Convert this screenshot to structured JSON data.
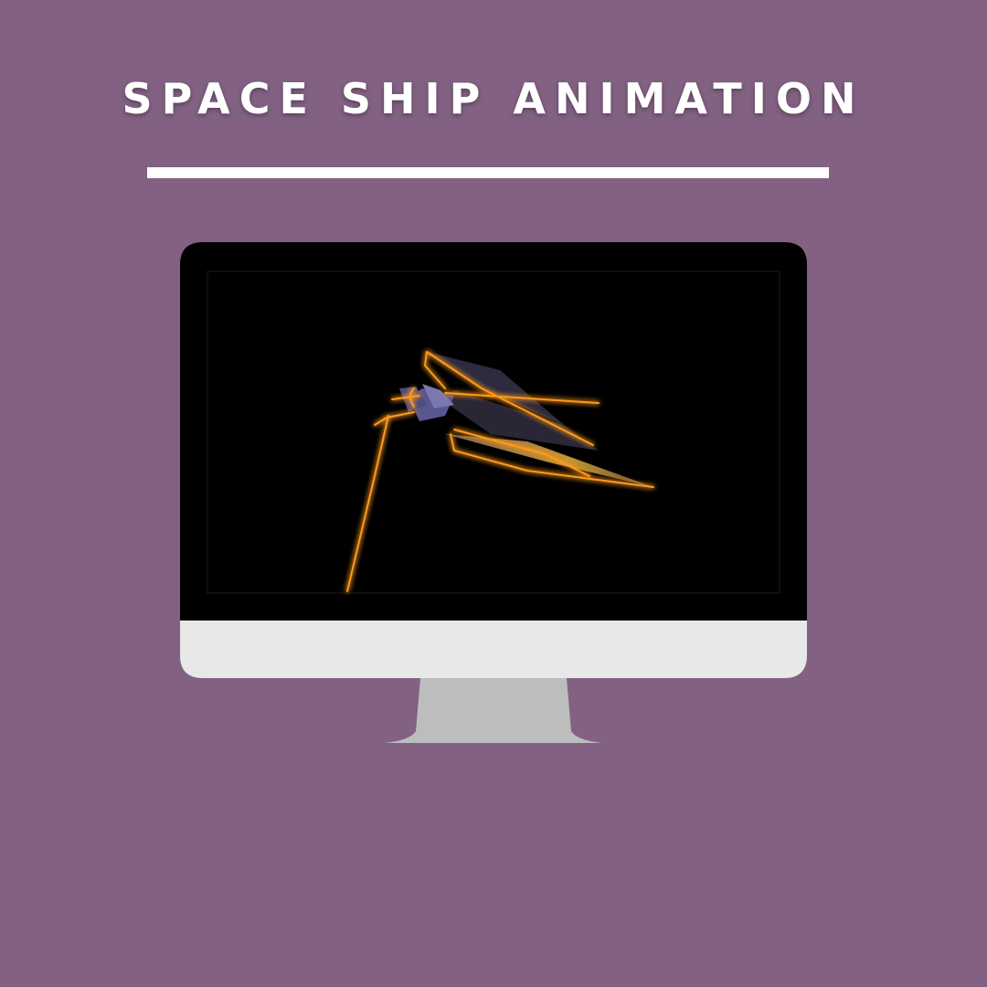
{
  "title": "SPACE SHIP ANIMATION",
  "colors": {
    "background": "#826182",
    "title_text": "#ffffff",
    "rule": "#ffffff",
    "monitor_bezel": "#000000",
    "monitor_chin": "#e8e8e8",
    "monitor_stand": "#bdbdbd",
    "ship_glow": "#ff9a1f",
    "ship_body": "#4a4870"
  },
  "icons": {
    "monitor": "desktop-monitor-icon",
    "spaceship": "spaceship-icon"
  }
}
